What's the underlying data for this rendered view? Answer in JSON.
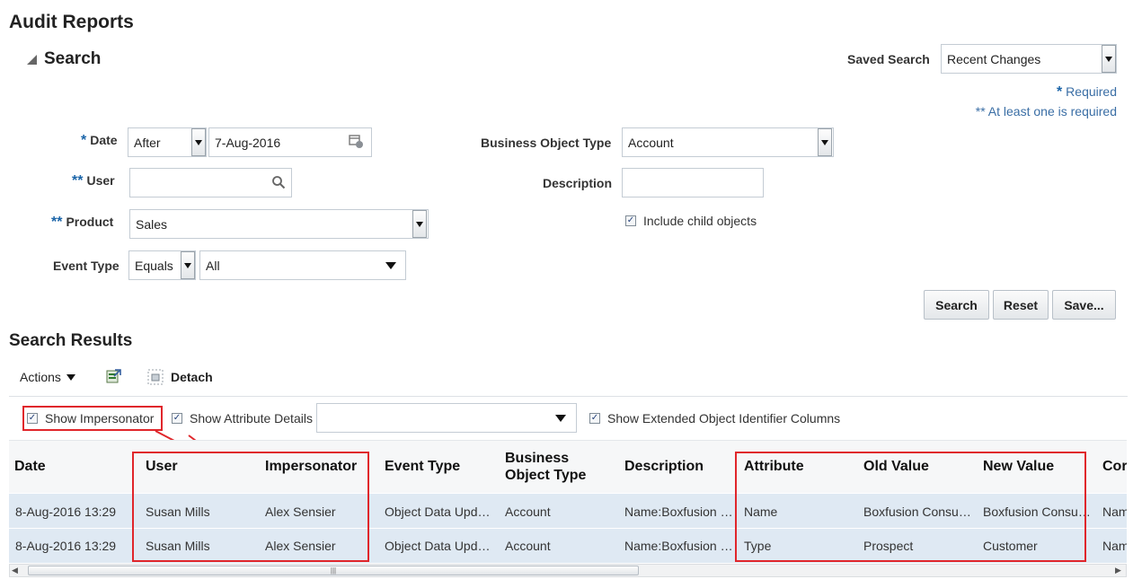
{
  "page_title": "Audit Reports",
  "search": {
    "title": "Search",
    "saved_search_label": "Saved Search",
    "saved_search_value": "Recent Changes",
    "required_note": "Required",
    "required_star": "*",
    "at_least_one_note": "** At least one is required",
    "date": {
      "star": "*",
      "label": "Date",
      "operator": "After",
      "value": "7-Aug-2016"
    },
    "user": {
      "star": "**",
      "label": "User",
      "value": ""
    },
    "product": {
      "star": "**",
      "label": "Product",
      "value": "Sales"
    },
    "event_type": {
      "label": "Event Type",
      "operator": "Equals",
      "value": "All"
    },
    "business_object_type": {
      "label": "Business Object Type",
      "value": "Account"
    },
    "description": {
      "label": "Description",
      "value": ""
    },
    "include_child_label": "Include child objects",
    "buttons": {
      "search": "Search",
      "reset": "Reset",
      "save": "Save..."
    }
  },
  "results": {
    "title": "Search Results",
    "actions_label": "Actions",
    "detach_label": "Detach",
    "show_impersonator": "Show Impersonator",
    "show_attribute_details": "Show Attribute Details",
    "show_extended": "Show Extended Object Identifier Columns",
    "columns": {
      "date": "Date",
      "user": "User",
      "impersonator": "Impersonator",
      "event_type": "Event Type",
      "bot_line1": "Business",
      "bot_line2": "Object Type",
      "description": "Description",
      "attribute": "Attribute",
      "old_value": "Old Value",
      "new_value": "New Value",
      "cor": "Cor"
    },
    "rows": [
      {
        "date": "8-Aug-2016 13:29",
        "user": "Susan Mills",
        "impersonator": "Alex Sensier",
        "event_type": "Object Data Upd…",
        "bot": "Account",
        "description": "Name:Boxfusion …",
        "attribute": "Name",
        "old_value": "Boxfusion Consu…",
        "new_value": "Boxfusion Consu…",
        "cor": "Nam"
      },
      {
        "date": "8-Aug-2016 13:29",
        "user": "Susan Mills",
        "impersonator": "Alex Sensier",
        "event_type": "Object Data Upd…",
        "bot": "Account",
        "description": "Name:Boxfusion …",
        "attribute": "Type",
        "old_value": "Prospect",
        "new_value": "Customer",
        "cor": "Nam"
      }
    ]
  },
  "colors": {
    "accent": "#1a64a8",
    "highlight": "#e0262b",
    "row": "#dfe9f3"
  }
}
